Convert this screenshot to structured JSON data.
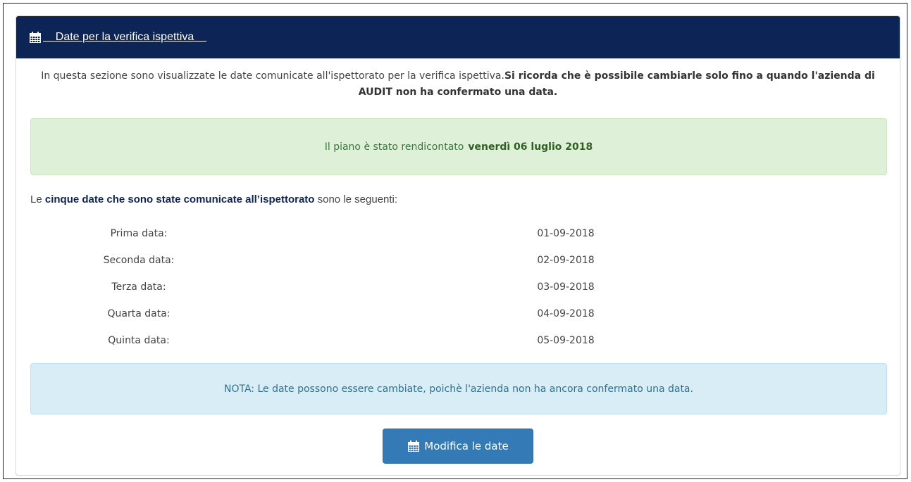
{
  "panel": {
    "title": "Date per la verifica ispettiva",
    "title_icon": "calendar-icon"
  },
  "intro": {
    "text_normal": "In questa sezione sono visualizzate le date comunicate all'ispettorato per la verifica ispettiva.",
    "text_bold": "Si ricorda che è possibile cambiarle solo fino a quando l'azienda di AUDIT non ha confermato una data."
  },
  "success_alert": {
    "text": "Il piano è stato rendicontato",
    "date": "venerdì 06 luglio 2018"
  },
  "dates_intro": {
    "prefix": "Le",
    "highlight": "cinque date che sono state comunicate all’ispettorato",
    "suffix": "sono le seguenti:"
  },
  "dates": [
    {
      "label": "Prima data:",
      "value": "01-09-2018"
    },
    {
      "label": "Seconda data:",
      "value": "02-09-2018"
    },
    {
      "label": "Terza data:",
      "value": "03-09-2018"
    },
    {
      "label": "Quarta data:",
      "value": "04-09-2018"
    },
    {
      "label": "Quinta data:",
      "value": "05-09-2018"
    }
  ],
  "info_alert": {
    "text": "NOTA: Le date possono essere cambiate, poichè l'azienda non ha ancora confermato una data."
  },
  "button": {
    "label": "Modifica le date",
    "icon": "calendar-icon"
  },
  "colors": {
    "header": "#0d2457",
    "success_bg": "#dff0d8",
    "info_bg": "#d9edf7",
    "button": "#337ab7"
  }
}
